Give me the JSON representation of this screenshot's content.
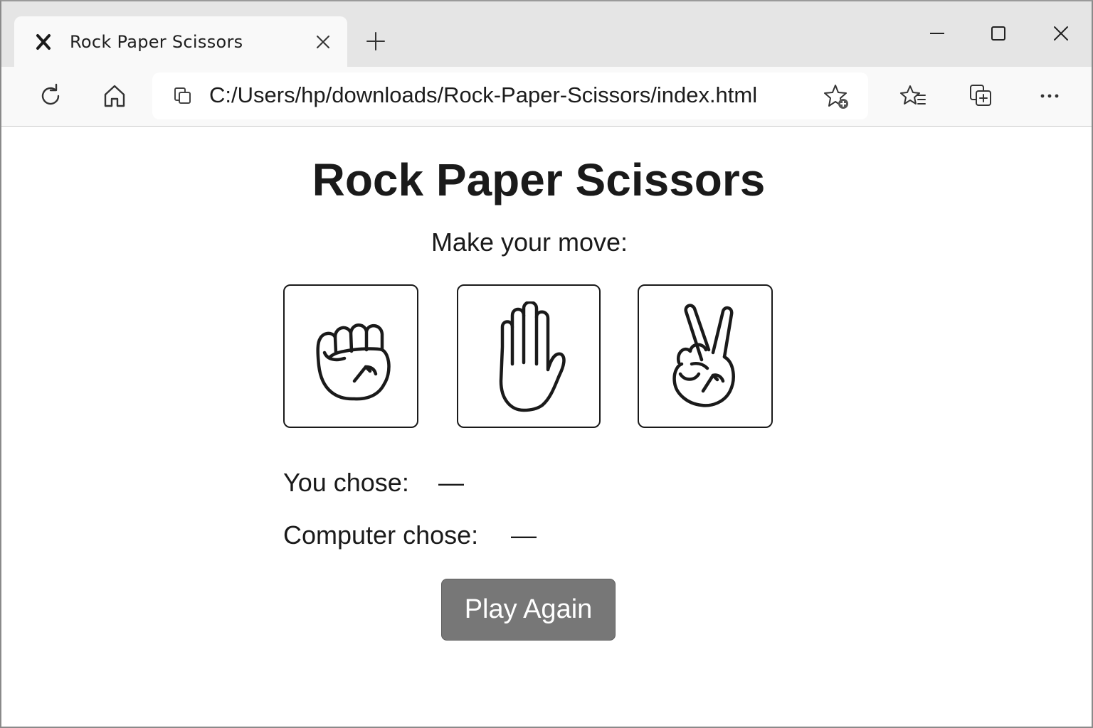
{
  "browser": {
    "tab": {
      "title": "Rock  Paper  Scissors",
      "favicon": "x-favicon-icon"
    },
    "address": "C:/Users/hp/downloads/Rock-Paper-Scissors/index.html",
    "icons": [
      "refresh-icon",
      "home-icon",
      "page-info-icon",
      "add-favorite-icon",
      "favorites-icon",
      "collections-icon",
      "more-icon",
      "close-tab-icon",
      "new-tab-icon",
      "minimize-icon",
      "maximize-icon",
      "close-window-icon"
    ]
  },
  "game": {
    "title": "Rock Paper Scissors",
    "prompt": "Make your move:",
    "choices": [
      {
        "name": "rock",
        "icon": "fist-icon"
      },
      {
        "name": "paper",
        "icon": "open-hand-icon"
      },
      {
        "name": "scissors",
        "icon": "victory-hand-icon"
      }
    ],
    "you_chose_label": "You chose:",
    "you_chose_value": "—",
    "computer_chose_label": "Computer chose:",
    "computer_chose_value": "—",
    "play_again_label": "Play Again"
  },
  "colors": {
    "tabstrip": "#e5e5e5",
    "toolbar": "#f9f9f9",
    "button": "#777777",
    "text": "#1a1a1a"
  }
}
